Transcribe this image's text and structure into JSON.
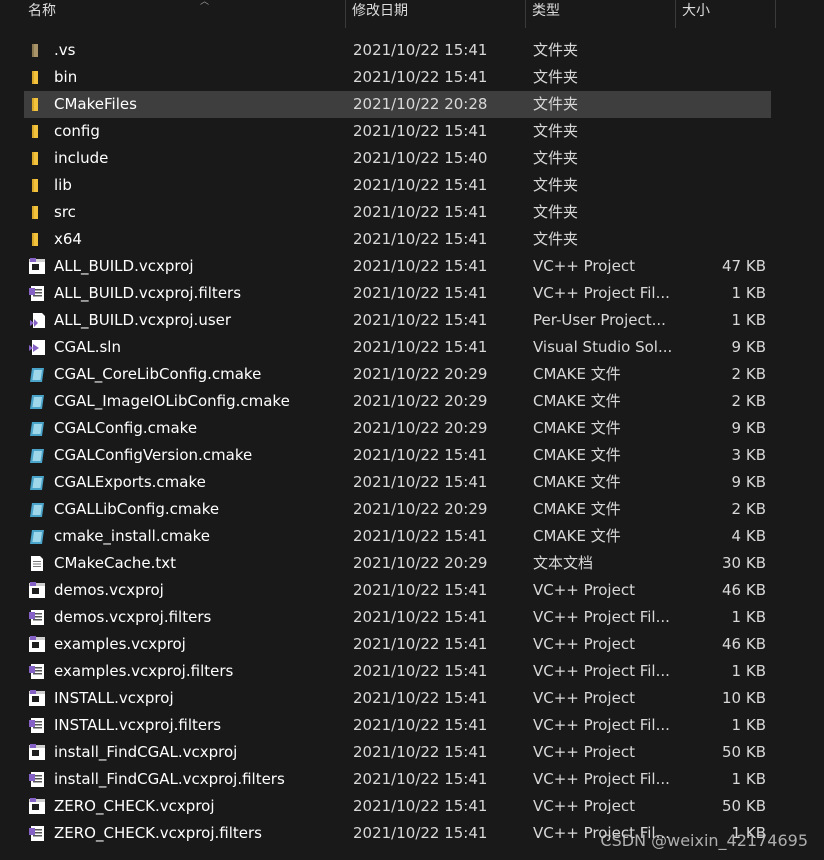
{
  "columns": {
    "name": "名称",
    "date": "修改日期",
    "type": "类型",
    "size": "大小"
  },
  "selected_index": 2,
  "files": [
    {
      "name": ".vs",
      "date": "2021/10/22 15:41",
      "type": "文件夹",
      "size": "",
      "icon": "folder-dim-icon"
    },
    {
      "name": "bin",
      "date": "2021/10/22 15:41",
      "type": "文件夹",
      "size": "",
      "icon": "folder-icon"
    },
    {
      "name": "CMakeFiles",
      "date": "2021/10/22 20:28",
      "type": "文件夹",
      "size": "",
      "icon": "folder-icon"
    },
    {
      "name": "config",
      "date": "2021/10/22 15:41",
      "type": "文件夹",
      "size": "",
      "icon": "folder-icon"
    },
    {
      "name": "include",
      "date": "2021/10/22 15:40",
      "type": "文件夹",
      "size": "",
      "icon": "folder-icon"
    },
    {
      "name": "lib",
      "date": "2021/10/22 15:41",
      "type": "文件夹",
      "size": "",
      "icon": "folder-icon"
    },
    {
      "name": "src",
      "date": "2021/10/22 15:41",
      "type": "文件夹",
      "size": "",
      "icon": "folder-icon"
    },
    {
      "name": "x64",
      "date": "2021/10/22 15:41",
      "type": "文件夹",
      "size": "",
      "icon": "folder-icon"
    },
    {
      "name": "ALL_BUILD.vcxproj",
      "date": "2021/10/22 15:41",
      "type": "VC++ Project",
      "size": "47 KB",
      "icon": "vcxproj-icon"
    },
    {
      "name": "ALL_BUILD.vcxproj.filters",
      "date": "2021/10/22 15:41",
      "type": "VC++ Project Fil...",
      "size": "1 KB",
      "icon": "filters-icon"
    },
    {
      "name": "ALL_BUILD.vcxproj.user",
      "date": "2021/10/22 15:41",
      "type": "Per-User Project...",
      "size": "1 KB",
      "icon": "user-project-icon"
    },
    {
      "name": "CGAL.sln",
      "date": "2021/10/22 15:41",
      "type": "Visual Studio Sol...",
      "size": "9 KB",
      "icon": "solution-icon"
    },
    {
      "name": "CGAL_CoreLibConfig.cmake",
      "date": "2021/10/22 20:29",
      "type": "CMAKE 文件",
      "size": "2 KB",
      "icon": "cmake-icon"
    },
    {
      "name": "CGAL_ImageIOLibConfig.cmake",
      "date": "2021/10/22 20:29",
      "type": "CMAKE 文件",
      "size": "2 KB",
      "icon": "cmake-icon"
    },
    {
      "name": "CGALConfig.cmake",
      "date": "2021/10/22 20:29",
      "type": "CMAKE 文件",
      "size": "9 KB",
      "icon": "cmake-icon"
    },
    {
      "name": "CGALConfigVersion.cmake",
      "date": "2021/10/22 15:41",
      "type": "CMAKE 文件",
      "size": "3 KB",
      "icon": "cmake-icon"
    },
    {
      "name": "CGALExports.cmake",
      "date": "2021/10/22 15:41",
      "type": "CMAKE 文件",
      "size": "9 KB",
      "icon": "cmake-icon"
    },
    {
      "name": "CGALLibConfig.cmake",
      "date": "2021/10/22 20:29",
      "type": "CMAKE 文件",
      "size": "2 KB",
      "icon": "cmake-icon"
    },
    {
      "name": "cmake_install.cmake",
      "date": "2021/10/22 15:41",
      "type": "CMAKE 文件",
      "size": "4 KB",
      "icon": "cmake-icon"
    },
    {
      "name": "CMakeCache.txt",
      "date": "2021/10/22 20:29",
      "type": "文本文档",
      "size": "30 KB",
      "icon": "text-file-icon"
    },
    {
      "name": "demos.vcxproj",
      "date": "2021/10/22 15:41",
      "type": "VC++ Project",
      "size": "46 KB",
      "icon": "vcxproj-icon"
    },
    {
      "name": "demos.vcxproj.filters",
      "date": "2021/10/22 15:41",
      "type": "VC++ Project Fil...",
      "size": "1 KB",
      "icon": "filters-icon"
    },
    {
      "name": "examples.vcxproj",
      "date": "2021/10/22 15:41",
      "type": "VC++ Project",
      "size": "46 KB",
      "icon": "vcxproj-icon"
    },
    {
      "name": "examples.vcxproj.filters",
      "date": "2021/10/22 15:41",
      "type": "VC++ Project Fil...",
      "size": "1 KB",
      "icon": "filters-icon"
    },
    {
      "name": "INSTALL.vcxproj",
      "date": "2021/10/22 15:41",
      "type": "VC++ Project",
      "size": "10 KB",
      "icon": "vcxproj-icon"
    },
    {
      "name": "INSTALL.vcxproj.filters",
      "date": "2021/10/22 15:41",
      "type": "VC++ Project Fil...",
      "size": "1 KB",
      "icon": "filters-icon"
    },
    {
      "name": "install_FindCGAL.vcxproj",
      "date": "2021/10/22 15:41",
      "type": "VC++ Project",
      "size": "50 KB",
      "icon": "vcxproj-icon"
    },
    {
      "name": "install_FindCGAL.vcxproj.filters",
      "date": "2021/10/22 15:41",
      "type": "VC++ Project Fil...",
      "size": "1 KB",
      "icon": "filters-icon"
    },
    {
      "name": "ZERO_CHECK.vcxproj",
      "date": "2021/10/22 15:41",
      "type": "VC++ Project",
      "size": "50 KB",
      "icon": "vcxproj-icon"
    },
    {
      "name": "ZERO_CHECK.vcxproj.filters",
      "date": "2021/10/22 15:41",
      "type": "VC++ Project Fil...",
      "size": "1 KB",
      "icon": "filters-icon"
    }
  ],
  "watermark": "CSDN @weixin_42174695",
  "colors": {
    "background": "#191919",
    "selected_row": "#3e3e3e",
    "folder": "#f2c23c",
    "cmake": "#4aa3c8",
    "vs_purple": "#8661c5"
  }
}
